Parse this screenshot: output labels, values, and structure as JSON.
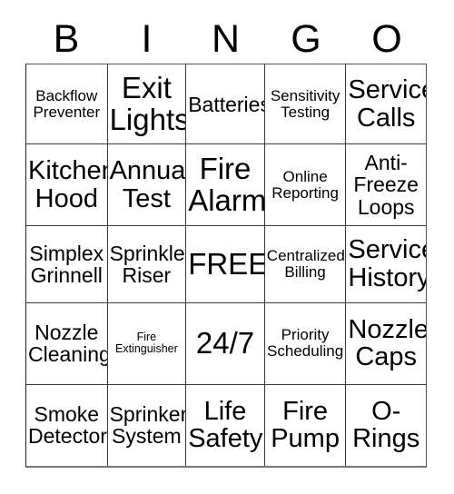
{
  "card": {
    "title_letters": [
      "B",
      "I",
      "N",
      "G",
      "O"
    ],
    "free_space_label": "FREE!",
    "colors": {
      "background": "#ffffff",
      "text": "#000000",
      "grid_line": "#3a3a3a",
      "outer_border": "#555555"
    },
    "grid": {
      "columns": 5,
      "rows": 5,
      "cells": [
        [
          {
            "text": "Backflow Preventer",
            "size": "sm"
          },
          {
            "text": "Exit Lights",
            "size": "xl"
          },
          {
            "text": "Batteries",
            "size": "md"
          },
          {
            "text": "Sensitivity Testing",
            "size": "sm"
          },
          {
            "text": "Service Calls",
            "size": "lg"
          }
        ],
        [
          {
            "text": "Kitchen Hood",
            "size": "lg"
          },
          {
            "text": "Annual Test",
            "size": "lg"
          },
          {
            "text": "Fire Alarm",
            "size": "xl"
          },
          {
            "text": "Online Reporting",
            "size": "sm"
          },
          {
            "text": "Anti-Freeze Loops",
            "size": "md"
          }
        ],
        [
          {
            "text": "Simplex Grinnell",
            "size": "md"
          },
          {
            "text": "Sprinkler Riser",
            "size": "md"
          },
          {
            "text": "FREE!",
            "size": "xl"
          },
          {
            "text": "Centralized Billing",
            "size": "sm"
          },
          {
            "text": "Service History",
            "size": "lg"
          }
        ],
        [
          {
            "text": "Nozzle Cleaning",
            "size": "md"
          },
          {
            "text": "Fire Extinguisher",
            "size": "xxs"
          },
          {
            "text": "24/7",
            "size": "xl"
          },
          {
            "text": "Priority Scheduling",
            "size": "sm"
          },
          {
            "text": "Nozzle Caps",
            "size": "lg"
          }
        ],
        [
          {
            "text": "Smoke Detector",
            "size": "md"
          },
          {
            "text": "Sprinker System",
            "size": "md"
          },
          {
            "text": "Life Safety",
            "size": "lg"
          },
          {
            "text": "Fire Pump",
            "size": "lg"
          },
          {
            "text": "O-Rings",
            "size": "lg"
          }
        ]
      ]
    }
  }
}
